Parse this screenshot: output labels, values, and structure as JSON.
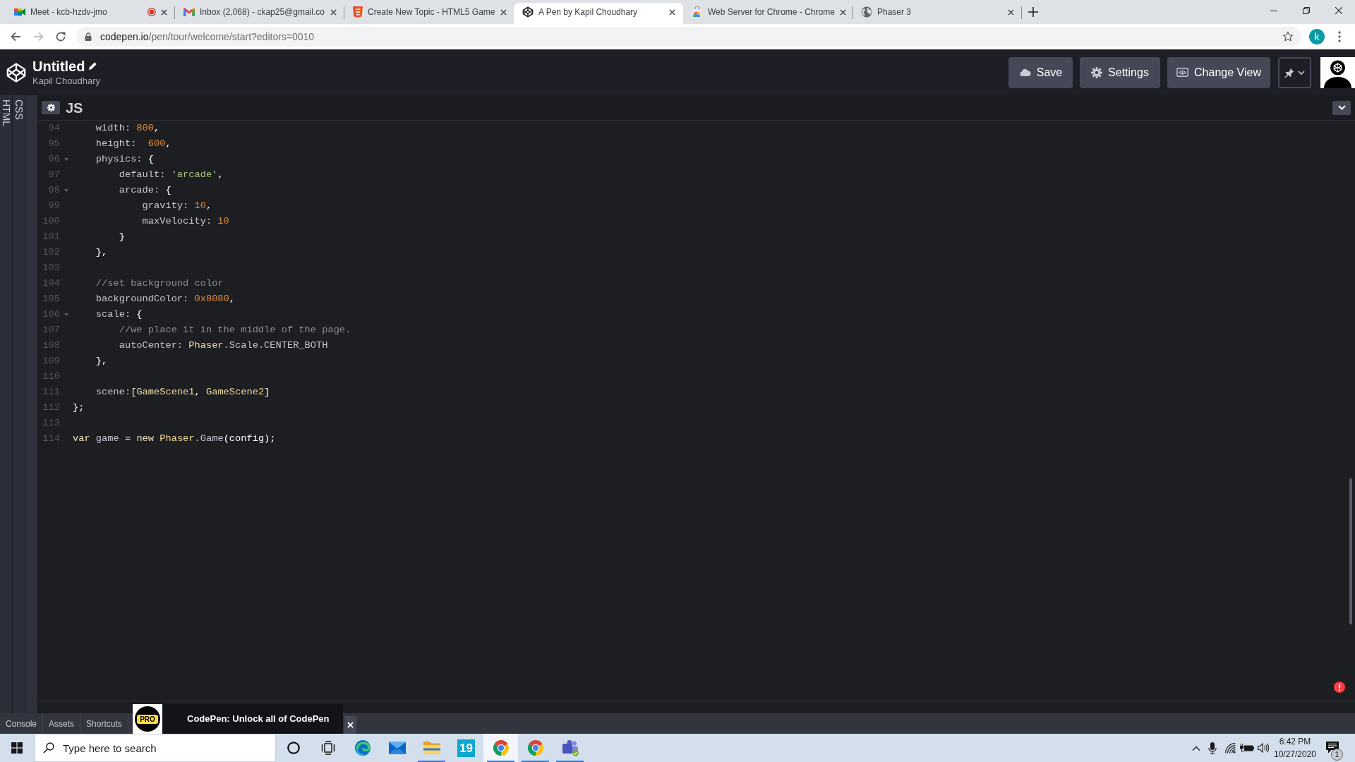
{
  "browser": {
    "tabs": [
      {
        "title": "Meet - kcb-hzdv-jmo",
        "kind": "meet",
        "recording": true,
        "selected": false
      },
      {
        "title": "Inbox (2,068) - ckap25@gmail.co",
        "kind": "mail",
        "recording": false,
        "selected": false
      },
      {
        "title": "Create New Topic - HTML5 Game",
        "kind": "html5",
        "recording": false,
        "selected": false
      },
      {
        "title": "A Pen by Kapil Choudhary",
        "kind": "codepen",
        "recording": false,
        "selected": true
      },
      {
        "title": "Web Server for Chrome - Chrome",
        "kind": "store",
        "recording": false,
        "selected": false
      },
      {
        "title": "Phaser 3",
        "kind": "globe",
        "recording": false,
        "selected": false
      }
    ],
    "nav": {
      "back_disabled": false,
      "forward_disabled": true
    },
    "address": {
      "domain": "codepen.io",
      "path": "/pen/tour/welcome/start?editors=0010"
    },
    "profile_initial": "k"
  },
  "pen": {
    "title": "Untitled",
    "author": "Kapil Choudhary",
    "buttons": [
      {
        "label": "Save",
        "kind": "save"
      },
      {
        "label": "Settings",
        "kind": "settings"
      },
      {
        "label": "Change View",
        "kind": "view"
      }
    ]
  },
  "side_panels": [
    {
      "label": "HTML"
    },
    {
      "label": "CSS"
    }
  ],
  "editor": {
    "title": "JS",
    "lines": [
      {
        "number": "94",
        "fold": false,
        "tokens": [
          {
            "text": "    width: ",
            "kind": "plain"
          },
          {
            "text": "800",
            "kind": "number"
          },
          {
            "text": ",",
            "kind": "punct"
          }
        ]
      },
      {
        "number": "95",
        "fold": false,
        "tokens": [
          {
            "text": "    height:  ",
            "kind": "plain"
          },
          {
            "text": "600",
            "kind": "number"
          },
          {
            "text": ",",
            "kind": "punct"
          }
        ]
      },
      {
        "number": "96",
        "fold": true,
        "tokens": [
          {
            "text": "    physics: ",
            "kind": "plain"
          },
          {
            "text": "{",
            "kind": "punct"
          }
        ]
      },
      {
        "number": "97",
        "fold": false,
        "tokens": [
          {
            "text": "        default: ",
            "kind": "plain"
          },
          {
            "text": "'arcade'",
            "kind": "string"
          },
          {
            "text": ",",
            "kind": "punct"
          }
        ]
      },
      {
        "number": "98",
        "fold": true,
        "tokens": [
          {
            "text": "        arcade: ",
            "kind": "plain"
          },
          {
            "text": "{",
            "kind": "punct"
          }
        ]
      },
      {
        "number": "99",
        "fold": false,
        "tokens": [
          {
            "text": "            gravity: ",
            "kind": "plain"
          },
          {
            "text": "10",
            "kind": "number"
          },
          {
            "text": ",",
            "kind": "punct"
          }
        ]
      },
      {
        "number": "100",
        "fold": false,
        "tokens": [
          {
            "text": "            maxVelocity: ",
            "kind": "plain"
          },
          {
            "text": "10",
            "kind": "number"
          }
        ]
      },
      {
        "number": "101",
        "fold": false,
        "tokens": [
          {
            "text": "        }",
            "kind": "punct"
          }
        ]
      },
      {
        "number": "102",
        "fold": false,
        "tokens": [
          {
            "text": "    },",
            "kind": "punct"
          }
        ]
      },
      {
        "number": "103",
        "fold": false
      },
      {
        "number": "104",
        "fold": false,
        "tokens": [
          {
            "text": "    //set background color",
            "kind": "comment"
          }
        ]
      },
      {
        "number": "105",
        "fold": false,
        "tokens": [
          {
            "text": "    backgroundColor: ",
            "kind": "plain"
          },
          {
            "text": "0x8080",
            "kind": "number"
          },
          {
            "text": ",",
            "kind": "punct"
          }
        ]
      },
      {
        "number": "106",
        "fold": true,
        "tokens": [
          {
            "text": "    scale: ",
            "kind": "plain"
          },
          {
            "text": "{",
            "kind": "punct"
          }
        ]
      },
      {
        "number": "107",
        "fold": false,
        "tokens": [
          {
            "text": "        //we place it in the middle of the page.",
            "kind": "comment"
          }
        ]
      },
      {
        "number": "108",
        "fold": false,
        "tokens": [
          {
            "text": "        autoCenter: ",
            "kind": "plain"
          },
          {
            "text": "Phaser",
            "kind": "name"
          },
          {
            "text": ".Scale.CENTER_BOTH",
            "kind": "plain"
          }
        ]
      },
      {
        "number": "109",
        "fold": false,
        "tokens": [
          {
            "text": "    },",
            "kind": "punct"
          }
        ]
      },
      {
        "number": "110",
        "fold": false
      },
      {
        "number": "111",
        "fold": false,
        "tokens": [
          {
            "text": "    scene:",
            "kind": "plain"
          },
          {
            "text": "[",
            "kind": "punct"
          },
          {
            "text": "GameScene1",
            "kind": "name"
          },
          {
            "text": ", ",
            "kind": "punct"
          },
          {
            "text": "GameScene2",
            "kind": "name"
          },
          {
            "text": "]",
            "kind": "punct"
          }
        ]
      },
      {
        "number": "112",
        "fold": false,
        "tokens": [
          {
            "text": "};",
            "kind": "punct"
          }
        ]
      },
      {
        "number": "113",
        "fold": false
      },
      {
        "number": "114",
        "fold": false,
        "tokens": [
          {
            "text": "var",
            "kind": "keyword"
          },
          {
            "text": " game ",
            "kind": "plain"
          },
          {
            "text": "=",
            "kind": "punct"
          },
          {
            "text": " new ",
            "kind": "keyword"
          },
          {
            "text": "Phaser",
            "kind": "name"
          },
          {
            "text": ".Game",
            "kind": "plain"
          },
          {
            "text": "(config);",
            "kind": "punct"
          }
        ]
      }
    ]
  },
  "footer": {
    "tabs": [
      {
        "label": "Console"
      },
      {
        "label": "Assets"
      },
      {
        "label": "Shortcuts"
      }
    ],
    "promo": {
      "badge": "PRO",
      "text": "CodePen: Unlock all of CodePen"
    }
  },
  "taskbar": {
    "search": {
      "placeholder": "Type here to search"
    },
    "apps": [
      {
        "kind": "cortana",
        "running": false,
        "selected": false
      },
      {
        "kind": "taskview",
        "running": false,
        "selected": false
      },
      {
        "kind": "edge",
        "running": false,
        "selected": false
      },
      {
        "kind": "mail",
        "running": false,
        "selected": false
      },
      {
        "kind": "explorer",
        "running": true,
        "selected": false
      },
      {
        "kind": "tile",
        "label": "19",
        "running": false,
        "selected": false
      },
      {
        "kind": "chrome",
        "running": true,
        "selected": true
      },
      {
        "kind": "chrome",
        "running": true,
        "selected": false
      },
      {
        "kind": "teams",
        "running": true,
        "selected": false
      }
    ],
    "time": "6:42 PM",
    "date": "10/27/2020",
    "notifications": "1"
  }
}
